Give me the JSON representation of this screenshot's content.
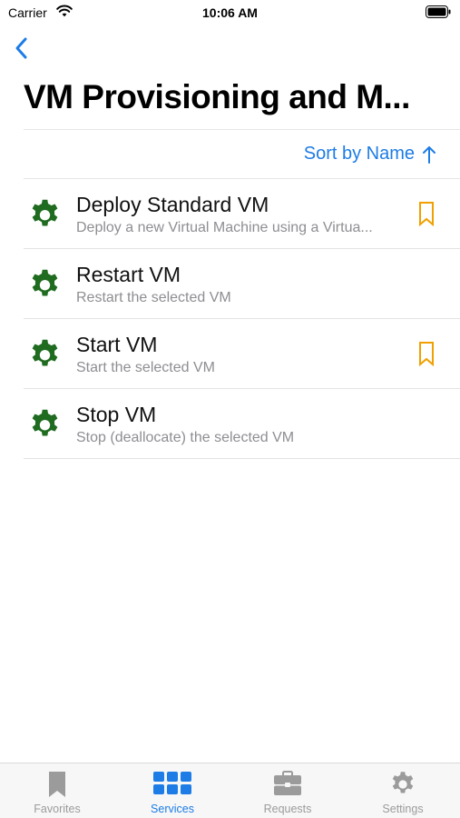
{
  "status_bar": {
    "carrier": "Carrier",
    "time": "10:06 AM"
  },
  "nav": {
    "title": "VM Provisioning and M..."
  },
  "sort": {
    "label": "Sort by Name"
  },
  "items": [
    {
      "title": "Deploy Standard VM",
      "subtitle": "Deploy a new Virtual Machine using a Virtua...",
      "bookmarked": true
    },
    {
      "title": "Restart VM",
      "subtitle": "Restart the selected VM",
      "bookmarked": false
    },
    {
      "title": "Start VM",
      "subtitle": "Start the selected VM",
      "bookmarked": true
    },
    {
      "title": "Stop VM",
      "subtitle": "Stop (deallocate) the selected VM",
      "bookmarked": false
    }
  ],
  "tabs": [
    {
      "label": "Favorites",
      "icon": "bookmark-icon",
      "active": false
    },
    {
      "label": "Services",
      "icon": "grid-icon",
      "active": true
    },
    {
      "label": "Requests",
      "icon": "briefcase-icon",
      "active": false
    },
    {
      "label": "Settings",
      "icon": "gear-icon",
      "active": false
    }
  ],
  "colors": {
    "accent": "#1d7ce6",
    "gear": "#1f6b1f",
    "bookmark": "#f0a000",
    "inactive_tab": "#9b9b9b"
  }
}
